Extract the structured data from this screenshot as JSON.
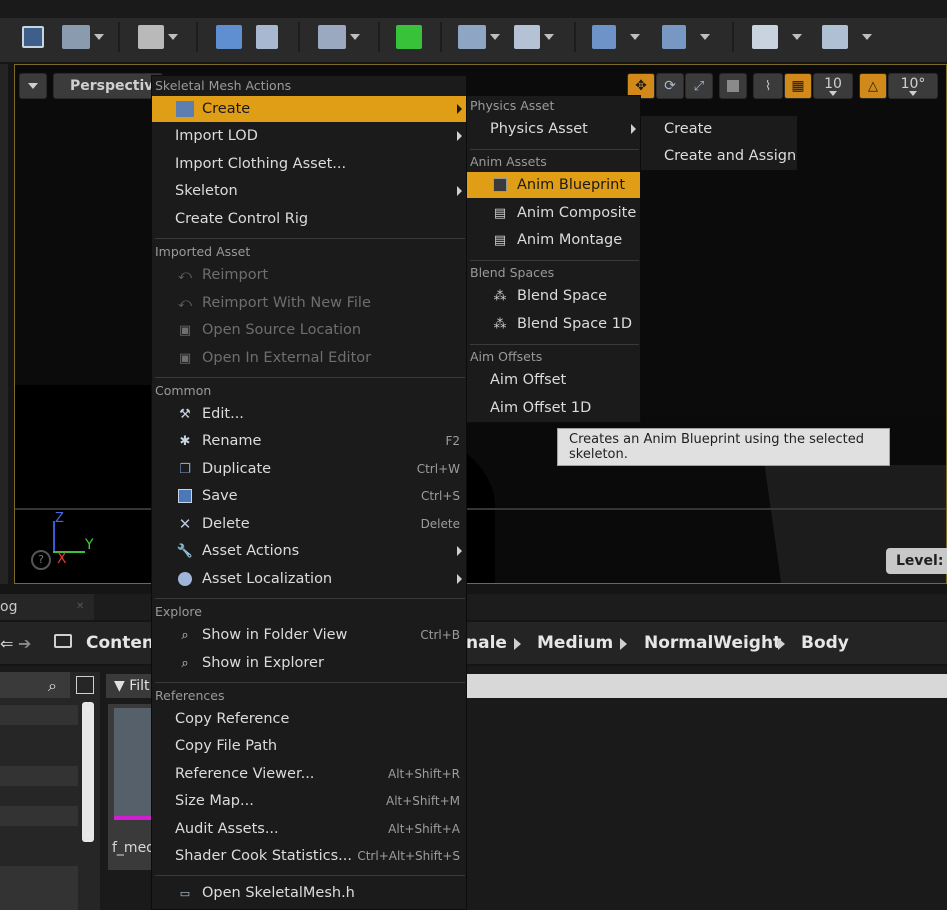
{
  "context_menu": {
    "title": "Skeletal Mesh Actions",
    "create": "Create",
    "import_lod": "Import LOD",
    "import_clothing": "Import Clothing Asset...",
    "skeleton": "Skeleton",
    "create_control_rig": "Create Control Rig",
    "sections": {
      "imported_asset": "Imported Asset",
      "common": "Common",
      "explore": "Explore",
      "references": "References"
    },
    "imported": {
      "reimport": "Reimport",
      "reimport_new": "Reimport With New File",
      "open_source": "Open Source Location",
      "open_external": "Open In External Editor"
    },
    "common": {
      "edit": "Edit...",
      "rename": "Rename",
      "rename_sc": "F2",
      "duplicate": "Duplicate",
      "duplicate_sc": "Ctrl+W",
      "save": "Save",
      "save_sc": "Ctrl+S",
      "delete": "Delete",
      "delete_sc": "Delete",
      "asset_actions": "Asset Actions",
      "asset_localization": "Asset Localization"
    },
    "explore": {
      "folder_view": "Show in Folder View",
      "folder_view_sc": "Ctrl+B",
      "explorer": "Show in Explorer"
    },
    "references": {
      "copy_reference": "Copy Reference",
      "copy_path": "Copy File Path",
      "ref_viewer": "Reference Viewer...",
      "ref_viewer_sc": "Alt+Shift+R",
      "size_map": "Size Map...",
      "size_map_sc": "Alt+Shift+M",
      "audit": "Audit Assets...",
      "audit_sc": "Alt+Shift+A",
      "shader_cook": "Shader Cook Statistics...",
      "shader_cook_sc": "Ctrl+Alt+Shift+S"
    },
    "open_header": "Open SkeletalMesh.h"
  },
  "create_submenu": {
    "physics_header": "Physics Asset",
    "physics_asset": "Physics Asset",
    "anim_header": "Anim Assets",
    "anim_blueprint": "Anim Blueprint",
    "anim_composite": "Anim Composite",
    "anim_montage": "Anim Montage",
    "blend_header": "Blend Spaces",
    "blend_space": "Blend Space",
    "blend_space_1d": "Blend Space 1D",
    "aim_header": "Aim Offsets",
    "aim_offset": "Aim Offset",
    "aim_offset_1d": "Aim Offset 1D"
  },
  "physics_submenu": {
    "create": "Create",
    "create_assign": "Create and Assign"
  },
  "tooltip": "Creates an Anim Blueprint using the selected skeleton.",
  "viewport": {
    "perspective": "Perspective",
    "grid_value": "10",
    "rotation_value": "10°",
    "level_label": "Level:",
    "axis_z": "Z",
    "axis_y": "Y",
    "axis_x": "X"
  },
  "content_browser": {
    "tab_label": "og",
    "path_root": "Content",
    "crumbs": [
      "nale",
      "Medium",
      "NormalWeight",
      "Body"
    ],
    "filter_label": "Filt",
    "asset_name": "f_med"
  },
  "colors": {
    "highlight": "#e09e17",
    "menu_bg": "#1b1b1b",
    "viewport_border": "#7a6a2a"
  }
}
